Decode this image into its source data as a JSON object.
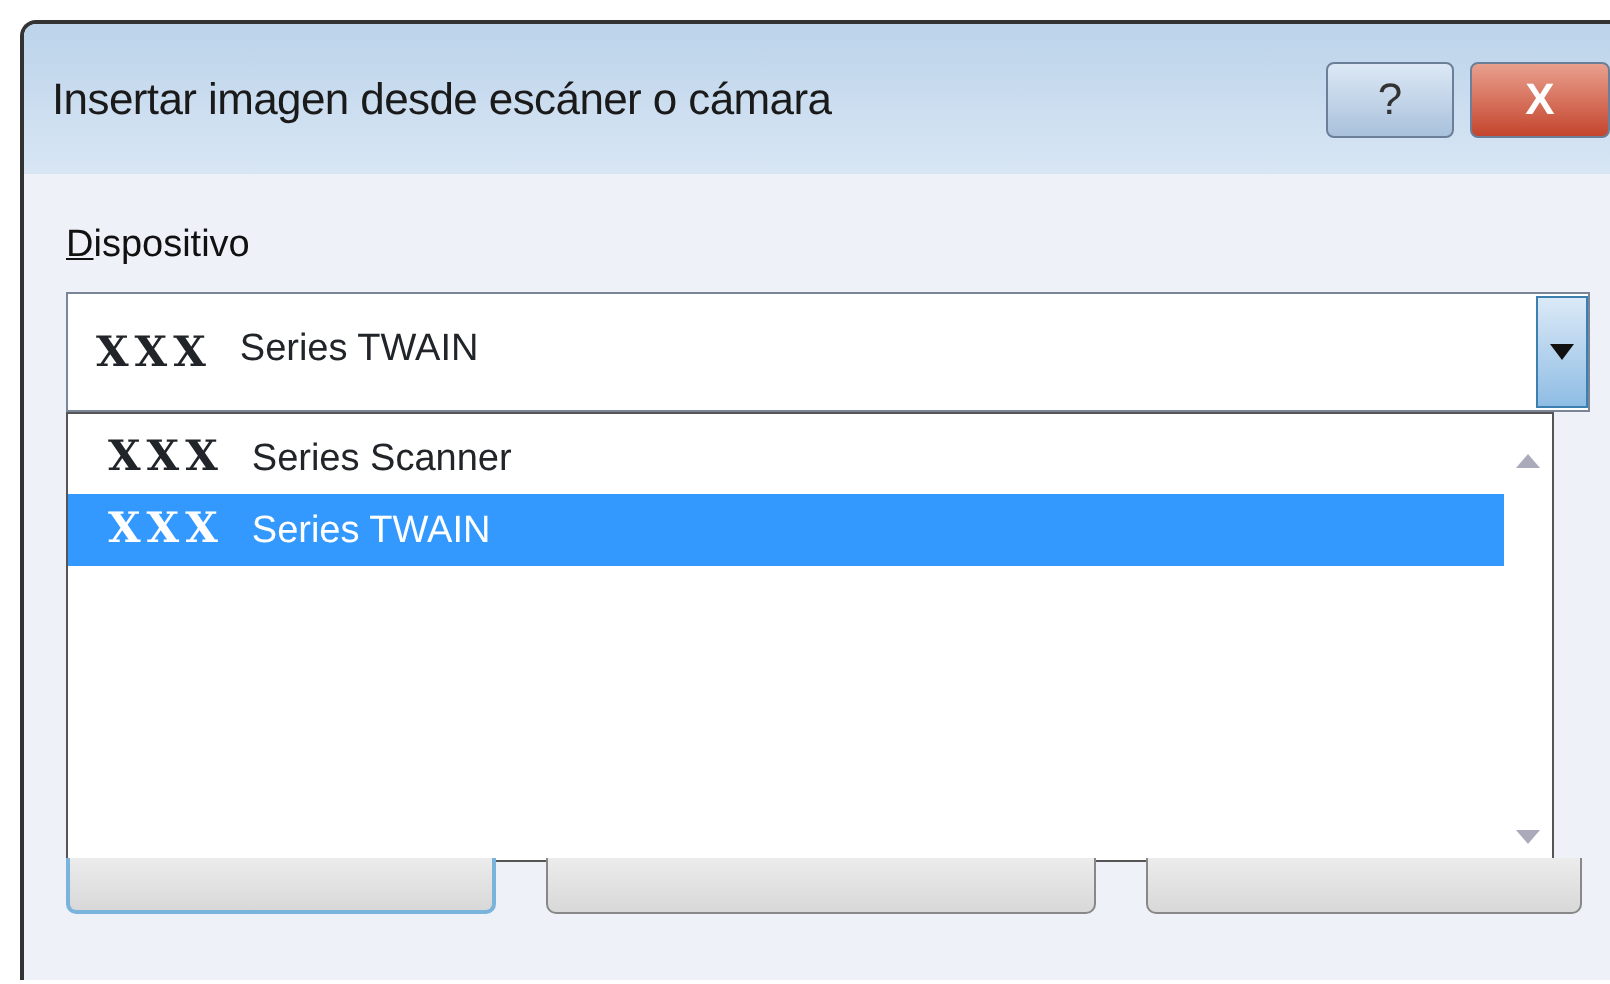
{
  "window": {
    "title": "Insertar imagen desde escáner o cámara"
  },
  "title_buttons": [
    {
      "kind": "help",
      "label": "?"
    },
    {
      "kind": "close",
      "label": "X"
    }
  ],
  "device": {
    "label": "Dispositivo",
    "value": {
      "brand": "XXX",
      "name": "Series TWAIN"
    },
    "expanded": true,
    "options": [
      {
        "brand": "XXX",
        "name": "Series Scanner",
        "selected": false
      },
      {
        "brand": "XXX",
        "name": "Series TWAIN",
        "selected": true
      }
    ]
  },
  "buttons": [
    {
      "default": true
    },
    {
      "default": false
    },
    {
      "default": false
    }
  ]
}
